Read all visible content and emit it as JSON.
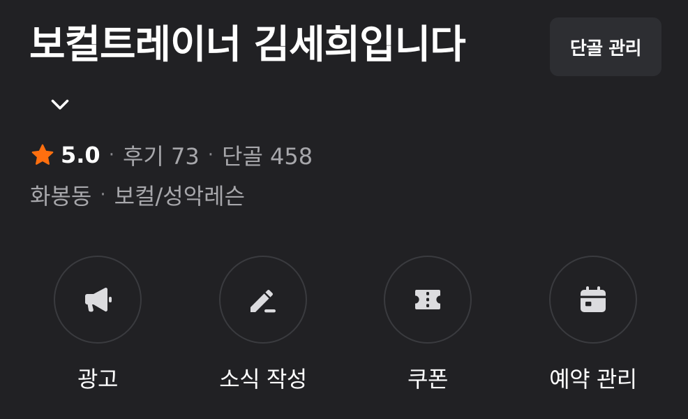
{
  "header": {
    "title": "보컬트레이너 김세희입니다",
    "manage_regulars_label": "단골 관리"
  },
  "stats": {
    "rating": "5.0",
    "separator": "·",
    "reviews": "후기 73",
    "regulars": "단골 458"
  },
  "meta": {
    "location": "화봉동",
    "separator": "·",
    "category": "보컬/성악레슨"
  },
  "actions": [
    {
      "label": "광고",
      "icon": "megaphone-icon"
    },
    {
      "label": "소식 작성",
      "icon": "pencil-icon"
    },
    {
      "label": "쿠폰",
      "icon": "coupon-icon"
    },
    {
      "label": "예약 관리",
      "icon": "calendar-icon"
    }
  ],
  "colors": {
    "background": "#212124",
    "star": "#ff6f0f",
    "muted_text": "#a7a7ab",
    "button_bg": "#2d2e32",
    "icon": "#dcdcdf"
  }
}
